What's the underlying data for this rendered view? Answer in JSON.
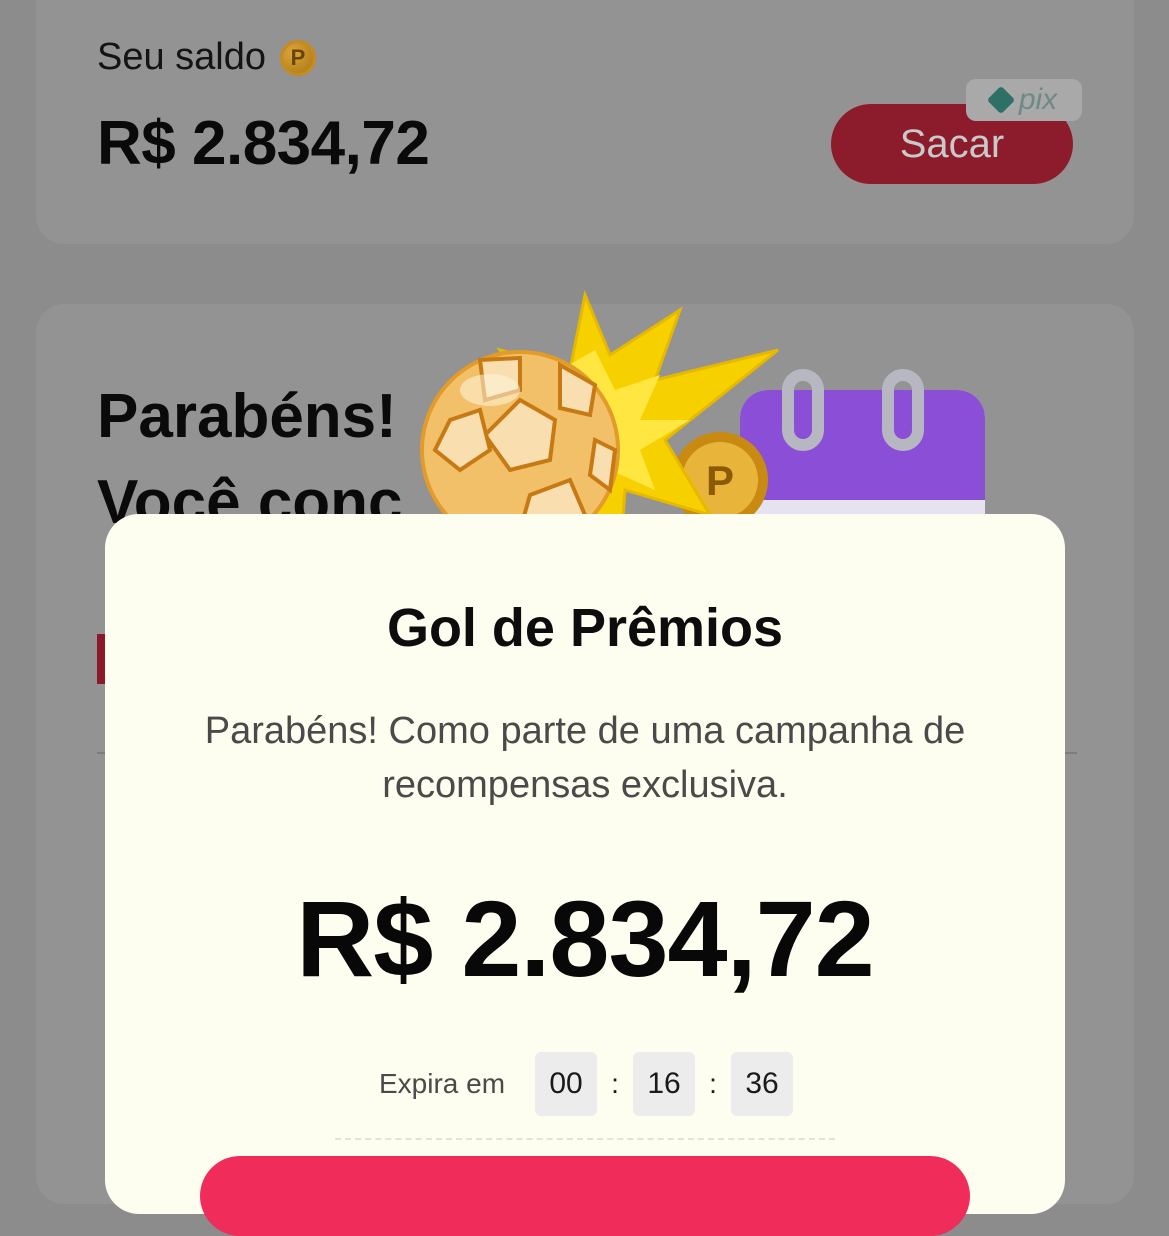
{
  "balance": {
    "label": "Seu saldo",
    "coin_icon": "P",
    "value": "R$ 2.834,72",
    "withdraw_label": "Sacar",
    "pix_label": "pix"
  },
  "promo": {
    "title_line1": "Parabéns!",
    "title_line2": "Você conc"
  },
  "modal": {
    "title": "Gol de Prêmios",
    "description": "Parabéns! Como parte de uma campanha de recompensas exclusiva.",
    "amount": "R$ 2.834,72",
    "timer": {
      "label": "Expira em",
      "hours": "00",
      "minutes": "16",
      "seconds": "36",
      "separator": ":"
    }
  },
  "colors": {
    "accent": "#ef2c5a",
    "modal_bg": "#fdfdf0",
    "overlay": "#8c8c8c"
  },
  "icons": [
    "coin-icon",
    "pix-logo-icon",
    "soccer-ball-icon",
    "burst-star-icon",
    "calendar-icon"
  ]
}
